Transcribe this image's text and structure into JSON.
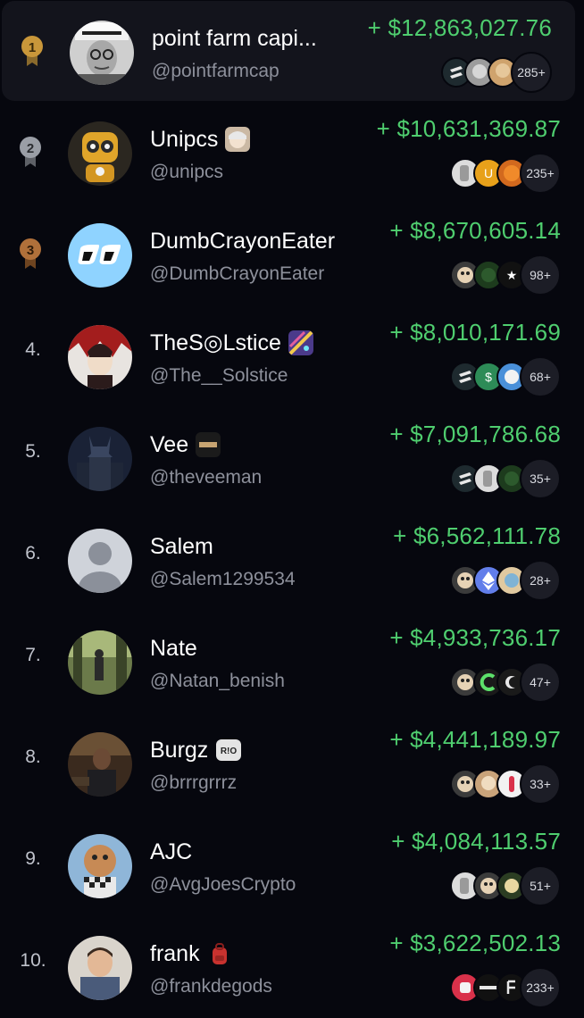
{
  "leaderboard": [
    {
      "rank": "1",
      "name": "point farm capi...",
      "handle": "@pointfarmcap",
      "pnl": "+ $12,863,027.76",
      "token_count": "285+",
      "medal": "gold",
      "name_icon": ""
    },
    {
      "rank": "2",
      "name": "Unipcs",
      "handle": "@unipcs",
      "pnl": "+ $10,631,369.87",
      "token_count": "235+",
      "medal": "silver",
      "name_icon": "anime-face-emoji"
    },
    {
      "rank": "3",
      "name": "DumbCrayonEater",
      "handle": "@DumbCrayonEater",
      "pnl": "+ $8,670,605.14",
      "token_count": "98+",
      "medal": "bronze",
      "name_icon": ""
    },
    {
      "rank": "4.",
      "name": "TheS◎Lstice",
      "handle": "@The__Solstice",
      "pnl": "+ $8,010,171.69",
      "token_count": "68+",
      "medal": "",
      "name_icon": "galaxy-emoji"
    },
    {
      "rank": "5.",
      "name": "Vee",
      "handle": "@theveeman",
      "pnl": "+ $7,091,786.68",
      "token_count": "35+",
      "medal": "",
      "name_icon": "dark-logo-emoji"
    },
    {
      "rank": "6.",
      "name": "Salem",
      "handle": "@Salem1299534",
      "pnl": "+ $6,562,111.78",
      "token_count": "28+",
      "medal": "",
      "name_icon": ""
    },
    {
      "rank": "7.",
      "name": "Nate",
      "handle": "@Natan_benish",
      "pnl": "+ $4,933,736.17",
      "token_count": "47+",
      "medal": "",
      "name_icon": ""
    },
    {
      "rank": "8.",
      "name": "Burgz",
      "handle": "@brrrgrrrz",
      "pnl": "+ $4,441,189.97",
      "token_count": "33+",
      "medal": "",
      "name_icon": "rio-badge"
    },
    {
      "rank": "9.",
      "name": "AJC",
      "handle": "@AvgJoesCrypto",
      "pnl": "+ $4,084,113.57",
      "token_count": "51+",
      "medal": "",
      "name_icon": ""
    },
    {
      "rank": "10.",
      "name": "frank",
      "handle": "@frankdegods",
      "pnl": "+ $3,622,502.13",
      "token_count": "233+",
      "medal": "",
      "name_icon": "red-backpack-emoji"
    }
  ],
  "badges": {
    "rio": "R!O"
  },
  "colors": {
    "background": "#06070e",
    "highlight_row": "#13141c",
    "pnl_green": "#4fce6f",
    "handle_gray": "#8d909b",
    "gold": "#c9973a",
    "silver": "#9a9ea6",
    "bronze": "#b0703a"
  }
}
